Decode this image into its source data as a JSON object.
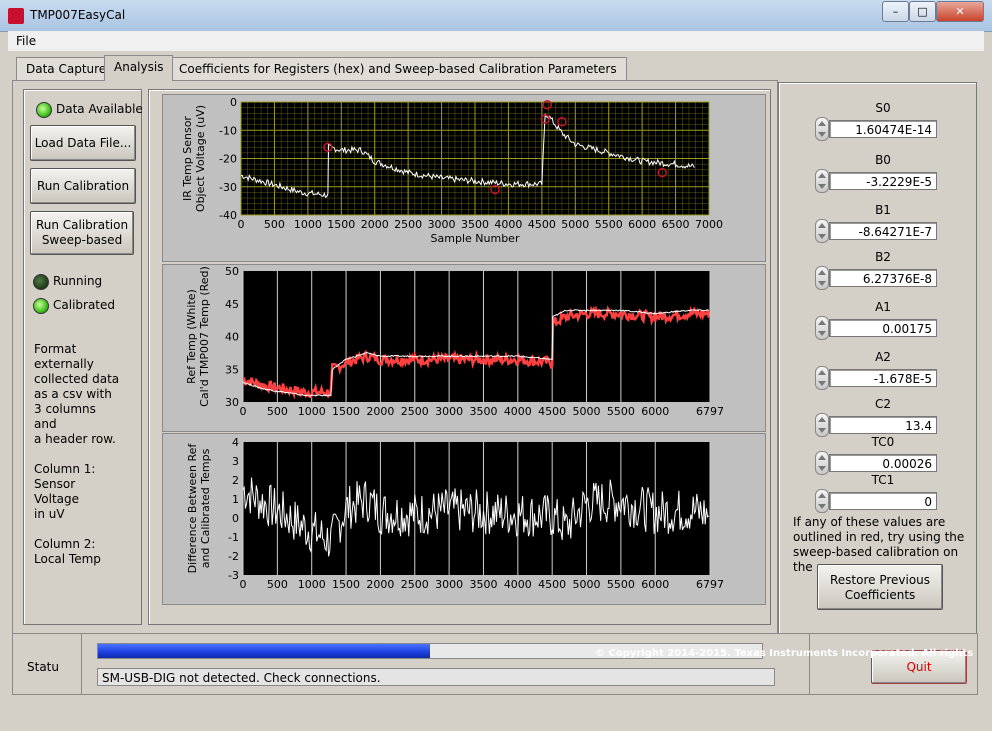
{
  "window": {
    "title": "TMP007EasyCal",
    "close_label": "✕",
    "min_label": "–",
    "max_label": "□"
  },
  "menu": {
    "file": "File"
  },
  "tabs": [
    {
      "label": "Data Capture"
    },
    {
      "label": "Analysis"
    },
    {
      "label": "Coefficients for Registers (hex) and Sweep-based Calibration Parameters"
    }
  ],
  "left": {
    "data_available": "Data Available",
    "load_button": "Load Data File...",
    "run_button": "Run Calibration",
    "sweep_button_line1": "Run Calibration",
    "sweep_button_line2": "Sweep-based",
    "running": "Running",
    "calibrated": "Calibrated",
    "instructions": [
      "Format",
      "externally",
      "collected data",
      "as a csv with",
      "3 columns",
      "and",
      "a header row.",
      "",
      "Column 1:",
      "Sensor",
      "Voltage",
      "in uV",
      "",
      "Column 2:",
      "Local Temp"
    ],
    "status": {
      "data_available_on": true,
      "running_on": false,
      "calibrated_on": true
    }
  },
  "coefficients": [
    {
      "label": "S0",
      "value": "1.60474E-14"
    },
    {
      "label": "B0",
      "value": "-3.2229E-5"
    },
    {
      "label": "B1",
      "value": "-8.64271E-7"
    },
    {
      "label": "B2",
      "value": "6.27376E-8"
    },
    {
      "label": "A1",
      "value": "0.00175"
    },
    {
      "label": "A2",
      "value": "-1.678E-5"
    },
    {
      "label": "C2",
      "value": "13.4"
    },
    {
      "label": "TC0",
      "value": "0.00026"
    },
    {
      "label": "TC1",
      "value": "0"
    }
  ],
  "right_note": [
    "If any of these values are",
    "outlined in red, try using the",
    "sweep-based calibration on the"
  ],
  "restore_line1": "Restore Previous",
  "restore_line2": "Coefficients",
  "status": {
    "label": "Statu",
    "progress": 0.5,
    "message": "SM-USB-DIG not detected. Check connections.",
    "quit": "Quit"
  },
  "copyright": "© Copyright 2014-2015. Texas Instruments Incorporated. All rights",
  "colors": {
    "plot_bg": "#000000",
    "grid_yellow": "#8a8a1a",
    "trace_white": "#ffffff",
    "trace_red": "#ff4040",
    "marker_red": "#c8102e",
    "progress_blue": "#1c3fe0",
    "led_green": "#3fbf1f"
  },
  "chart_data": [
    {
      "type": "line",
      "ylabel": "IR Temp Sensor Object Voltage (uV)",
      "xlabel": "Sample Number",
      "xlim": [
        0,
        7000
      ],
      "ylim": [
        -40,
        0
      ],
      "xticks": [
        "0",
        "500",
        "1000",
        "1500",
        "2000",
        "2500",
        "3000",
        "3500",
        "4000",
        "4500",
        "5000",
        "5500",
        "6000",
        "6500",
        "7000"
      ],
      "yticks": [
        "0",
        "-10",
        "-20",
        "-30",
        "-40"
      ],
      "grid": true,
      "series": [
        {
          "x": [
            0,
            300,
            600,
            900,
            1300,
            1310,
            1500,
            1800,
            2000,
            2500,
            3000,
            3500,
            4000,
            4500,
            4550,
            4600,
            4800,
            5000,
            5500,
            6000,
            6500,
            6800
          ],
          "values": [
            -26,
            -28,
            -30,
            -32,
            -33,
            -16,
            -17,
            -17,
            -21,
            -25,
            -27,
            -28,
            -29,
            -29,
            -4,
            -5,
            -11,
            -15,
            -18,
            -21,
            -22,
            -23
          ]
        }
      ],
      "markers": {
        "x": [
          1300,
          3800,
          4550,
          4580,
          4800,
          6300
        ],
        "values": [
          -16,
          -31,
          -6,
          -1,
          -7,
          -25
        ]
      }
    },
    {
      "type": "line",
      "ylabel": "Ref Temp (White) Cal'd TMP007 Temp (Red)",
      "xlim": [
        0,
        6797
      ],
      "ylim": [
        30,
        50
      ],
      "xticks": [
        "0",
        "500",
        "1000",
        "1500",
        "2000",
        "2500",
        "3000",
        "3500",
        "4000",
        "4500",
        "5000",
        "5500",
        "6000",
        "6797"
      ],
      "yticks": [
        "50",
        "45",
        "40",
        "35",
        "30"
      ],
      "grid": true,
      "series": [
        {
          "x": [
            0,
            300,
            600,
            900,
            1280,
            1300,
            1500,
            1800,
            2000,
            2500,
            3000,
            3500,
            4000,
            4500,
            4510,
            4700,
            5000,
            5500,
            6000,
            6500,
            6797
          ],
          "values": [
            33.5,
            32.5,
            32,
            31.5,
            31.5,
            35,
            36,
            37,
            36.5,
            36.5,
            36.5,
            36.5,
            36.5,
            36,
            42,
            43,
            43.5,
            43.5,
            43,
            43.5,
            43.5
          ]
        },
        {
          "x": [
            0,
            300,
            600,
            900,
            1280,
            1300,
            1500,
            1800,
            2000,
            2500,
            3000,
            3500,
            4000,
            4500,
            4510,
            4700,
            5000,
            5500,
            6000,
            6500,
            6797
          ],
          "values": [
            33,
            32,
            31.5,
            31,
            31,
            35,
            36.5,
            37.5,
            37,
            37,
            37,
            37,
            37,
            36.5,
            43,
            44,
            44,
            44,
            43.5,
            44,
            44
          ]
        }
      ]
    },
    {
      "type": "line",
      "ylabel": "Difference Between Ref and Calibrated Temps",
      "xlim": [
        0,
        6797
      ],
      "ylim": [
        -3,
        4
      ],
      "xticks": [
        "0",
        "500",
        "1000",
        "1500",
        "2000",
        "2500",
        "3000",
        "3500",
        "4000",
        "4500",
        "5000",
        "5500",
        "6000",
        "6797"
      ],
      "yticks": [
        "4",
        "3",
        "2",
        "1",
        "0",
        "-1",
        "-2",
        "-3"
      ],
      "grid": true,
      "series": [
        {
          "x": [
            0,
            300,
            600,
            900,
            1280,
            1500,
            1800,
            2000,
            2500,
            3000,
            3500,
            4000,
            4500,
            4700,
            5000,
            5500,
            6000,
            6500,
            6797
          ],
          "values": [
            1.5,
            0.8,
            0.2,
            -0.5,
            -1.2,
            0.5,
            1.0,
            0.3,
            0.2,
            0.4,
            0.3,
            0.2,
            0.1,
            -0.5,
            0.8,
            0.9,
            0.3,
            0.4,
            0.2
          ]
        }
      ]
    }
  ]
}
